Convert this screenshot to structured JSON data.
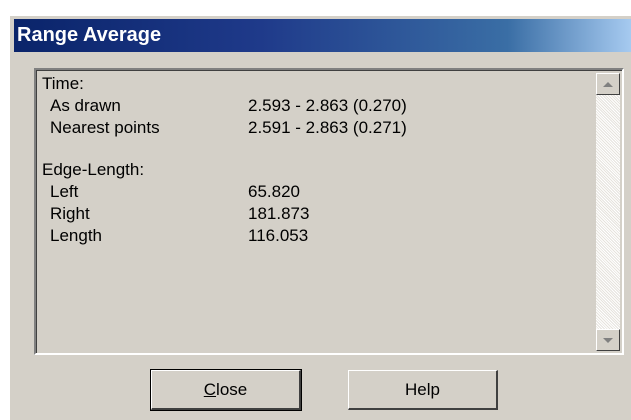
{
  "window": {
    "title": "Range Average"
  },
  "time": {
    "header": "Time:",
    "rows": [
      {
        "label": "As drawn",
        "value": "2.593 - 2.863 (0.270)"
      },
      {
        "label": "Nearest points",
        "value": "2.591 - 2.863 (0.271)"
      }
    ]
  },
  "edge": {
    "header": "Edge-Length:",
    "rows": [
      {
        "label": "Left",
        "value": "65.820"
      },
      {
        "label": "Right",
        "value": "181.873"
      },
      {
        "label": "Length",
        "value": "116.053"
      }
    ]
  },
  "buttons": {
    "close": "Close",
    "help": "Help"
  },
  "icons": {
    "scroll_up": "arrow-up-icon",
    "scroll_down": "arrow-down-icon"
  }
}
